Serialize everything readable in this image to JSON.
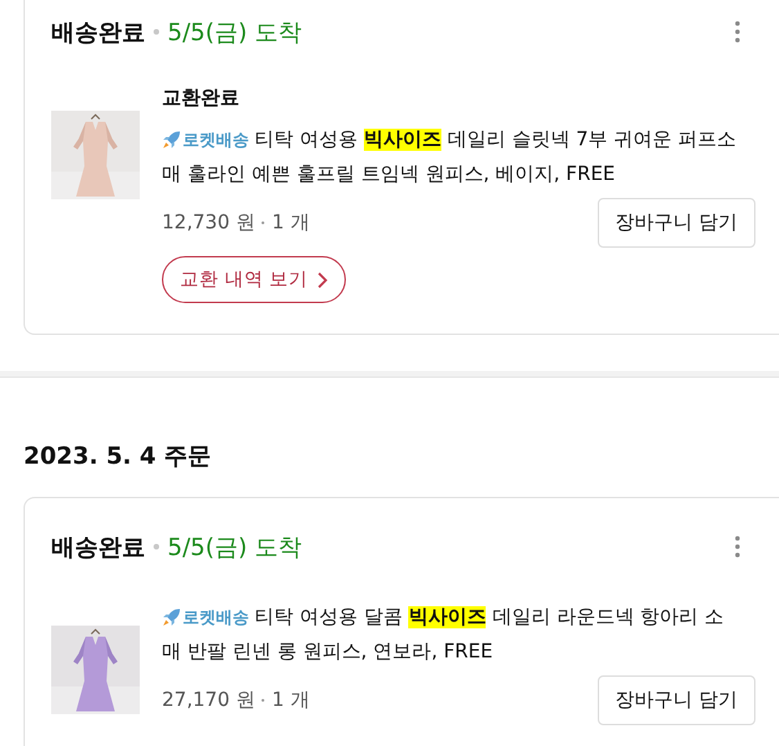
{
  "groups": [
    {
      "cards": [
        {
          "status": "배송완료",
          "arrival": "5/5(금) 도착",
          "items": [
            {
              "exchange_status": "교환완료",
              "badge": "로켓배송",
              "title_before": "티탁 여성용",
              "highlight": "빅사이즈",
              "title_after": "데일리 슬릿넥 7부 귀여운 퍼프소매 훌라인 예쁜 훌프릴 트임넥 원피스, 베이지, FREE",
              "price": "12,730 원",
              "quantity": "1 개",
              "cart_button": "장바구니 담기",
              "exchange_link": "교환 내역 보기"
            }
          ]
        }
      ]
    },
    {
      "date": "2023. 5. 4 주문",
      "cards": [
        {
          "status": "배송완료",
          "arrival": "5/5(금) 도착",
          "items": [
            {
              "badge": "로켓배송",
              "title_before": "티탁 여성용 달콤",
              "highlight": "빅사이즈",
              "title_after": "데일리 라운드넥 항아리 소매 반팔 린넨 롱 원피스, 연보라, FREE",
              "price": "27,170 원",
              "quantity": "1 개",
              "cart_button": "장바구니 담기"
            }
          ]
        }
      ]
    }
  ]
}
